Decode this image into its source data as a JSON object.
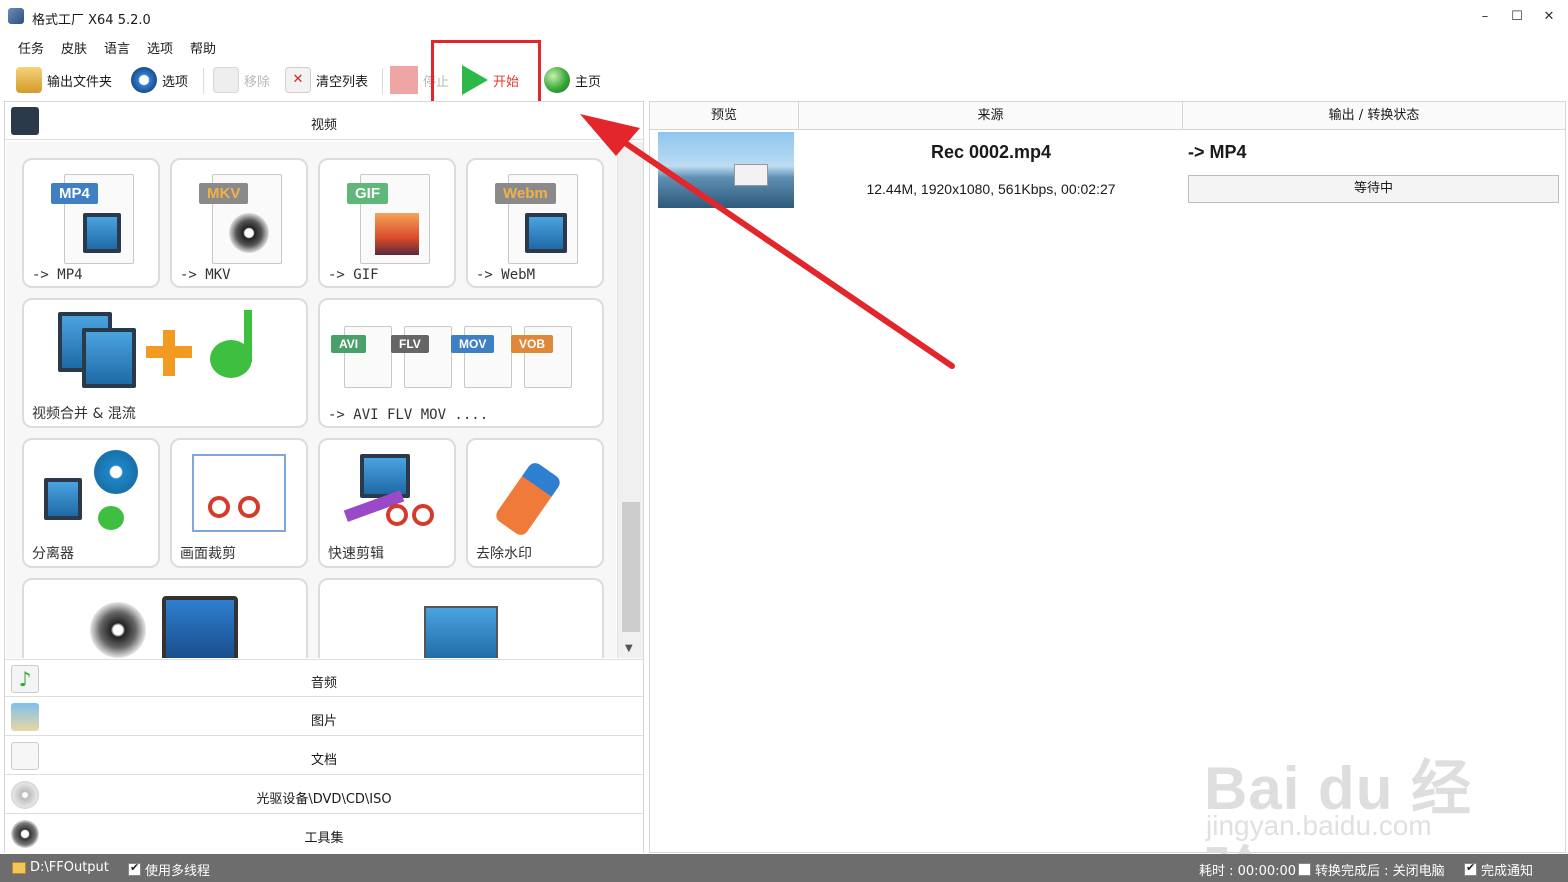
{
  "window": {
    "title": "格式工厂 X64 5.2.0",
    "minimize": "–",
    "maximize": "☐",
    "close": "✕"
  },
  "menu": [
    "任务",
    "皮肤",
    "语言",
    "选项",
    "帮助"
  ],
  "toolbar": {
    "output_folder": "输出文件夹",
    "options": "选项",
    "remove": "移除",
    "clear_list": "清空列表",
    "stop": "停止",
    "start": "开始",
    "home": "主页"
  },
  "categories": {
    "video": "视频",
    "audio": "音频",
    "image": "图片",
    "document": "文档",
    "disc": "光驱设备\\DVD\\CD\\ISO",
    "tools": "工具集"
  },
  "tiles": {
    "mp4": {
      "badge": "MP4",
      "label": "-> MP4"
    },
    "mkv": {
      "badge": "MKV",
      "label": "-> MKV"
    },
    "gif": {
      "badge": "GIF",
      "label": "-> GIF"
    },
    "webm": {
      "badge": "Webm",
      "label": "-> WebM"
    },
    "merge": {
      "label": "视频合并 & 混流"
    },
    "multi": {
      "badges": [
        "AVI",
        "FLV",
        "MOV",
        "VOB"
      ],
      "label": "-> AVI FLV MOV ...."
    },
    "splitter": {
      "label": "分离器"
    },
    "crop": {
      "label": "画面裁剪"
    },
    "quick_cut": {
      "label": "快速剪辑"
    },
    "remove_watermark": {
      "label": "去除水印"
    }
  },
  "task_list": {
    "columns": [
      "预览",
      "来源",
      "输出 / 转换状态"
    ],
    "rows": [
      {
        "file_name": "Rec 0002.mp4",
        "file_info": "12.44M, 1920x1080, 561Kbps, 00:02:27",
        "output": "-> MP4",
        "status": "等待中"
      }
    ]
  },
  "statusbar": {
    "output_path": "D:\\FFOutput",
    "multithread": "使用多线程",
    "elapsed": "耗时 : 00:00:00",
    "after_done": "转换完成后 : 关闭电脑",
    "notify": "完成通知"
  },
  "watermark": {
    "brand": "Bai du 经验",
    "url": "jingyan.baidu.com"
  },
  "colors": {
    "annotation_red": "#e3262b",
    "statusbar": "#6d6d6d",
    "start_green": "#2fb84a"
  }
}
